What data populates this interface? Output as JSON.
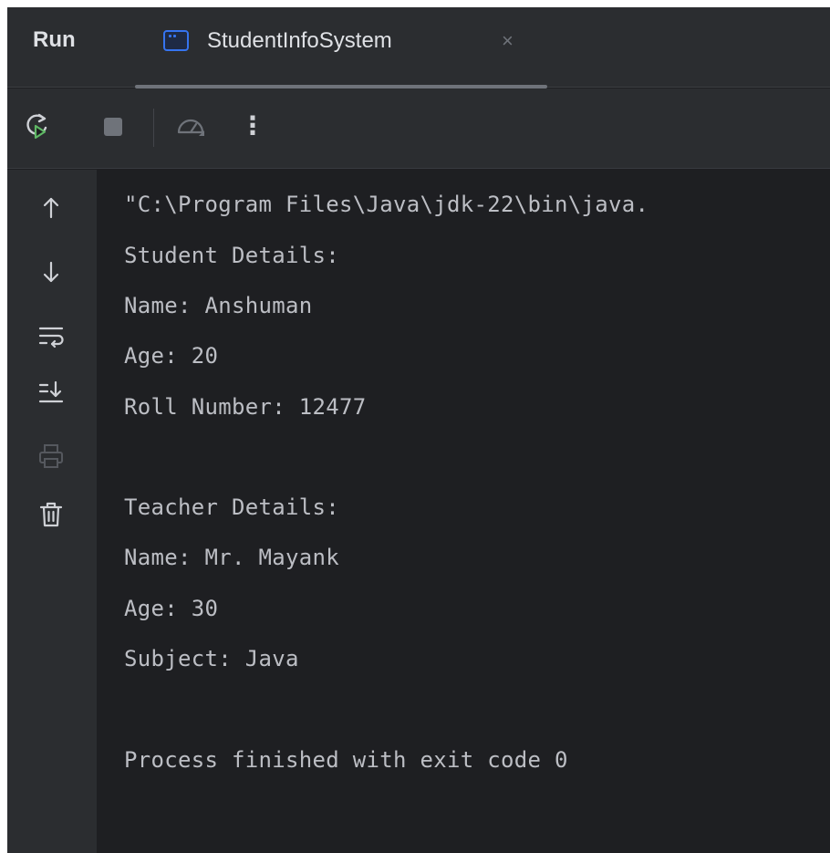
{
  "header": {
    "title": "Run",
    "tab": {
      "label": "StudentInfoSystem",
      "close": "×"
    }
  },
  "toolbar": {
    "rerun_icon": "rerun-icon",
    "stop_icon": "stop-icon",
    "profiler_icon": "profiler-icon",
    "more": "⋮"
  },
  "gutter": {
    "icons": [
      "arrow-up-icon",
      "arrow-down-icon",
      "soft-wrap-icon",
      "scroll-to-end-icon",
      "print-icon",
      "trash-icon"
    ]
  },
  "console": {
    "lines": [
      "\"C:\\Program Files\\Java\\jdk-22\\bin\\java.",
      "Student Details:",
      "Name: Anshuman",
      "Age: 20",
      "Roll Number: 12477",
      "",
      "Teacher Details:",
      "Name: Mr. Mayank",
      "Age: 30",
      "Subject: Java",
      "",
      "Process finished with exit code 0"
    ]
  },
  "colors": {
    "background": "#1e1f22",
    "panel": "#2b2d30",
    "accent": "#3574f0",
    "run_green": "#5fb865",
    "text": "#bcbec4"
  }
}
